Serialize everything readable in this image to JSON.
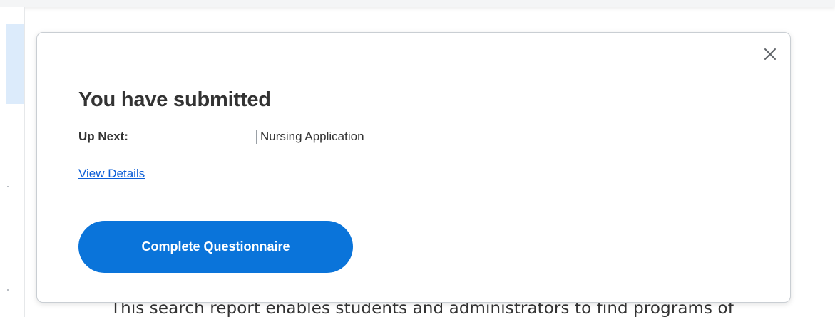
{
  "modal": {
    "title": "You have submitted",
    "up_next_label": "Up Next:",
    "up_next_value": "Nursing Application",
    "view_details_link": "View Details",
    "primary_button": "Complete Questionnaire",
    "close_icon": "close-icon"
  },
  "background": {
    "description_text": "This search report enables students and administrators to find programs of"
  },
  "colors": {
    "primary_button": "#0a74da",
    "link": "#0b5ed7",
    "rail_highlight": "#dcebfb",
    "text": "#333333"
  }
}
